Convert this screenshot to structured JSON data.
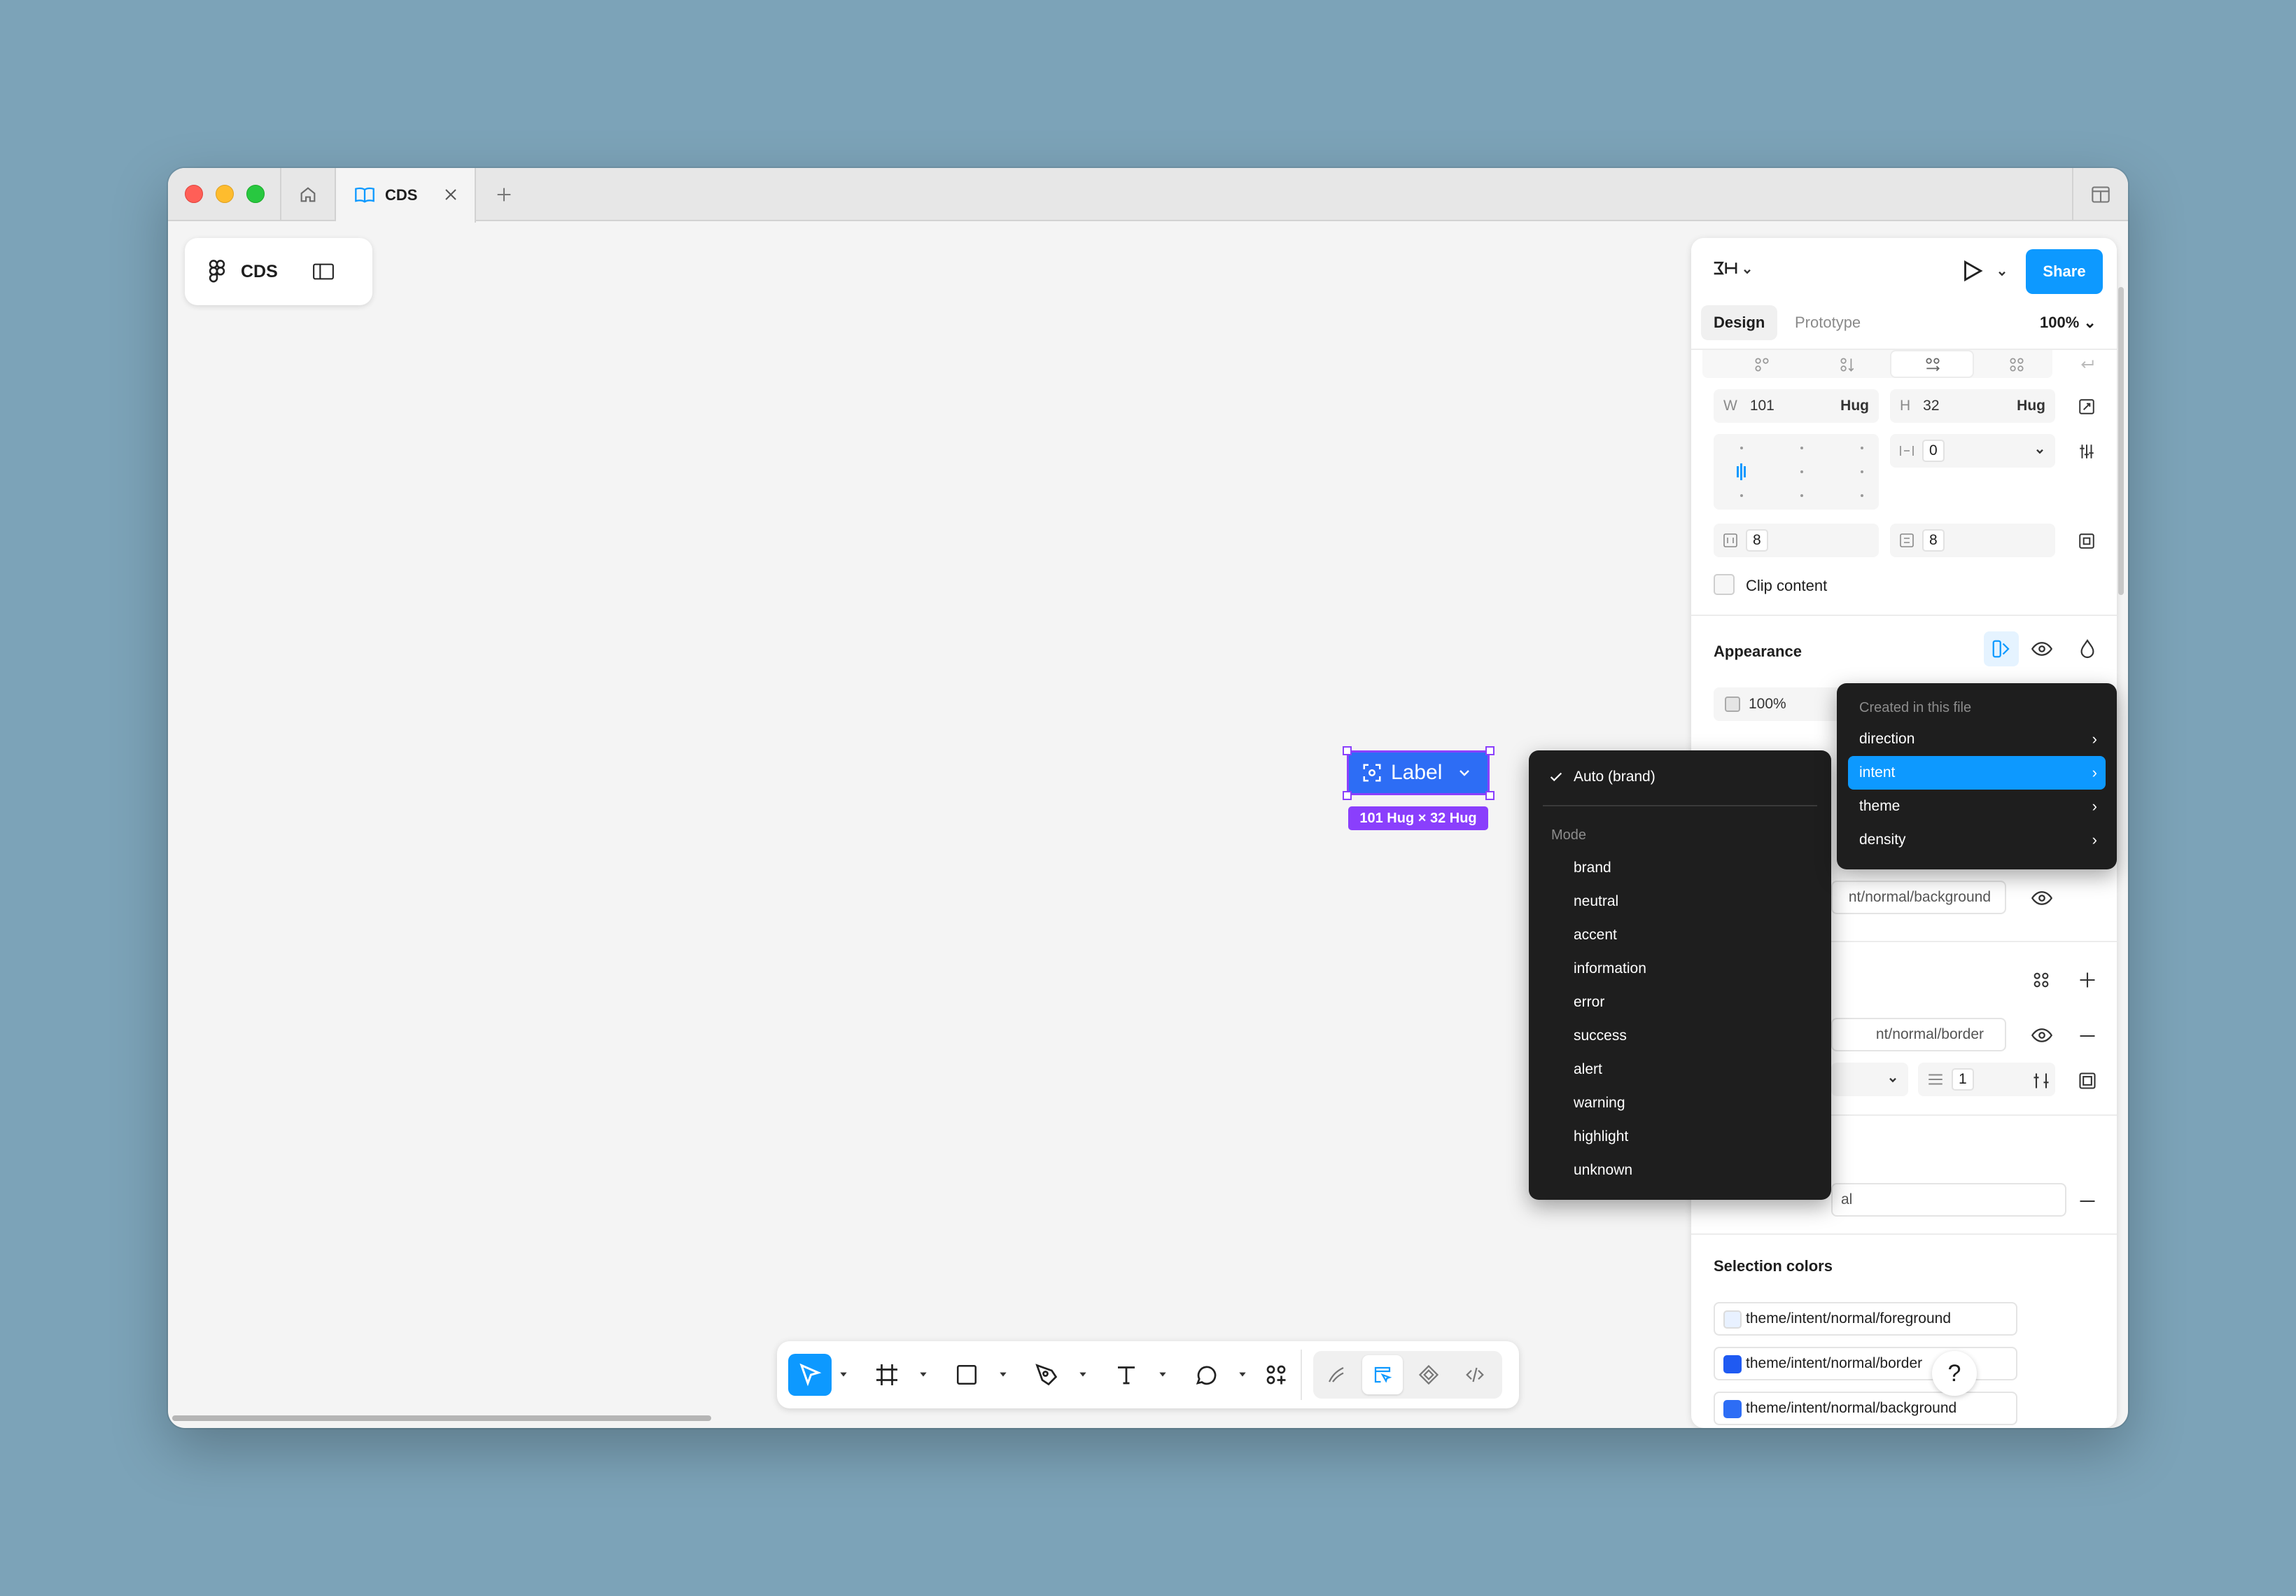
{
  "titlebar": {
    "tab_label": "CDS"
  },
  "canvas": {
    "file_name": "CDS",
    "button_label": "Label",
    "size_badge": "101 Hug × 32 Hug"
  },
  "panel": {
    "share_label": "Share",
    "tabs": [
      "Design",
      "Prototype"
    ],
    "zoom": "100%",
    "width": {
      "prefix": "W",
      "value": "101",
      "suffix": "Hug"
    },
    "height": {
      "prefix": "H",
      "value": "32",
      "suffix": "Hug"
    },
    "gap_value": "0",
    "padding_h": "8",
    "padding_v": "8",
    "clip_label": "Clip content",
    "appearance_title": "Appearance",
    "opacity": "100%",
    "fill_partial": "nt/normal/background",
    "stroke_partial": "nt/normal/border",
    "stroke_weight": "1",
    "effect_partial": "al",
    "selection_title": "Selection colors",
    "selection_colors": [
      {
        "name": "theme/intent/normal/foreground",
        "color": "#e8f1ff"
      },
      {
        "name": "theme/intent/normal/border",
        "color": "#1f5af2"
      },
      {
        "name": "theme/intent/normal/background",
        "color": "#2d6df5"
      }
    ],
    "help": "?"
  },
  "mode_menu": {
    "checked_label": "Auto (brand)",
    "header": "Mode",
    "items": [
      "brand",
      "neutral",
      "accent",
      "information",
      "error",
      "success",
      "alert",
      "warning",
      "highlight",
      "unknown"
    ]
  },
  "collection_menu": {
    "header": "Created in this file",
    "items": [
      "direction",
      "intent",
      "theme",
      "density"
    ],
    "active": "intent"
  },
  "colors": {
    "accent": "#0d99ff",
    "selection": "#8a3ffc",
    "button": "#2d6df5"
  }
}
